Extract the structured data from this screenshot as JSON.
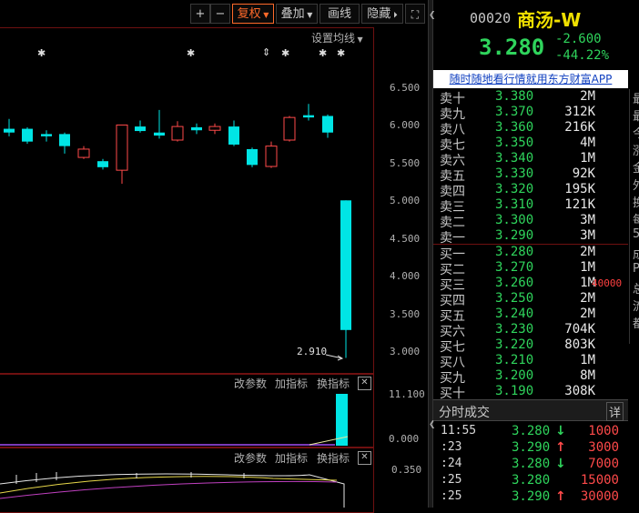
{
  "toolbar": {
    "plus": "+",
    "minus": "−",
    "adjust": "复权",
    "overlay": "叠加",
    "draw": "画线",
    "hide": "隐藏",
    "fullscreen_icon": "expand-icon"
  },
  "chart": {
    "ma_settings": "设置均线",
    "y_ticks": [
      "6.500",
      "6.000",
      "5.500",
      "5.000",
      "4.500",
      "4.000",
      "3.500",
      "3.000"
    ],
    "low_marker": "2.910",
    "vol_ticks": [
      "11.100",
      "0.000"
    ],
    "ind_ticks": [
      "0.350"
    ],
    "indicator_btns": [
      "改参数",
      "加指标",
      "换指标"
    ],
    "star_marks": [
      "✱",
      "✱",
      "✱",
      "✱",
      "✱"
    ],
    "updown_mark": "⇕"
  },
  "chart_data": {
    "type": "candlestick",
    "ylim": [
      2.9,
      6.6
    ],
    "candles": [
      {
        "o": 5.95,
        "c": 5.9,
        "h": 6.08,
        "l": 5.85
      },
      {
        "o": 5.95,
        "c": 5.78,
        "h": 5.97,
        "l": 5.75
      },
      {
        "o": 5.88,
        "c": 5.85,
        "h": 5.93,
        "l": 5.78
      },
      {
        "o": 5.88,
        "c": 5.72,
        "h": 5.9,
        "l": 5.62
      },
      {
        "o": 5.57,
        "c": 5.68,
        "h": 5.72,
        "l": 5.55
      },
      {
        "o": 5.52,
        "c": 5.44,
        "h": 5.55,
        "l": 5.41
      },
      {
        "o": 5.4,
        "c": 6.0,
        "h": 6.0,
        "l": 5.22
      },
      {
        "o": 5.98,
        "c": 5.92,
        "h": 6.06,
        "l": 5.9
      },
      {
        "o": 5.9,
        "c": 5.86,
        "h": 6.2,
        "l": 5.82
      },
      {
        "o": 5.8,
        "c": 5.98,
        "h": 6.05,
        "l": 5.78
      },
      {
        "o": 5.97,
        "c": 5.93,
        "h": 6.02,
        "l": 5.88
      },
      {
        "o": 5.93,
        "c": 5.98,
        "h": 6.02,
        "l": 5.88
      },
      {
        "o": 5.98,
        "c": 5.74,
        "h": 6.06,
        "l": 5.72
      },
      {
        "o": 5.68,
        "c": 5.47,
        "h": 5.7,
        "l": 5.44
      },
      {
        "o": 5.45,
        "c": 5.72,
        "h": 5.78,
        "l": 5.43
      },
      {
        "o": 5.8,
        "c": 6.1,
        "h": 6.12,
        "l": 5.78
      },
      {
        "o": 6.13,
        "c": 6.1,
        "h": 6.28,
        "l": 6.06
      },
      {
        "o": 6.12,
        "c": 5.9,
        "h": 6.14,
        "l": 5.83
      },
      {
        "o": 5.0,
        "c": 3.28,
        "h": 5.0,
        "l": 2.91
      }
    ]
  },
  "quote": {
    "code": "00020",
    "name": "商汤-W",
    "price": "3.280",
    "change": "-2.600",
    "change_pct": "-44.22%",
    "ad_link": "随时随地看行情就用东方财富APP"
  },
  "asks": [
    {
      "label": "卖十",
      "price": "3.380",
      "vol": "2M"
    },
    {
      "label": "卖九",
      "price": "3.370",
      "vol": "312K"
    },
    {
      "label": "卖八",
      "price": "3.360",
      "vol": "216K"
    },
    {
      "label": "卖七",
      "price": "3.350",
      "vol": "4M"
    },
    {
      "label": "卖六",
      "price": "3.340",
      "vol": "1M"
    },
    {
      "label": "卖五",
      "price": "3.330",
      "vol": "92K"
    },
    {
      "label": "卖四",
      "price": "3.320",
      "vol": "195K"
    },
    {
      "label": "卖三",
      "price": "3.310",
      "vol": "121K"
    },
    {
      "label": "卖二",
      "price": "3.300",
      "vol": "3M"
    },
    {
      "label": "卖一",
      "price": "3.290",
      "vol": "3M"
    }
  ],
  "bids": [
    {
      "label": "买一",
      "price": "3.280",
      "vol": "2M"
    },
    {
      "label": "买二",
      "price": "3.270",
      "vol": "1M"
    },
    {
      "label": "买三",
      "price": "3.260",
      "vol": "1M"
    },
    {
      "label": "买四",
      "price": "3.250",
      "vol": "2M"
    },
    {
      "label": "买五",
      "price": "3.240",
      "vol": "2M"
    },
    {
      "label": "买六",
      "price": "3.230",
      "vol": "704K"
    },
    {
      "label": "买七",
      "price": "3.220",
      "vol": "803K"
    },
    {
      "label": "买八",
      "price": "3.210",
      "vol": "1M"
    },
    {
      "label": "买九",
      "price": "3.200",
      "vol": "8M"
    },
    {
      "label": "买十",
      "price": "3.190",
      "vol": "308K"
    }
  ],
  "bid3_note": "40000",
  "trades": {
    "title": "分时成交",
    "detail": "详",
    "rows": [
      {
        "time": "11:55",
        "price": "3.280",
        "arrow": "↓",
        "dir": "down",
        "vol": "1000"
      },
      {
        "time": ":23",
        "price": "3.290",
        "arrow": "↑",
        "dir": "up",
        "vol": "3000"
      },
      {
        "time": ":24",
        "price": "3.280",
        "arrow": "↓",
        "dir": "down",
        "vol": "7000"
      },
      {
        "time": ":25",
        "price": "3.280",
        "arrow": "",
        "dir": "none",
        "vol": "15000"
      },
      {
        "time": ":25",
        "price": "3.290",
        "arrow": "↑",
        "dir": "up",
        "vol": "30000"
      }
    ]
  },
  "side_strip": [
    "最",
    "最",
    "今",
    "涨",
    "金",
    "外",
    "换",
    "每",
    "5",
    "成",
    "P",
    "总",
    "流",
    "都"
  ]
}
